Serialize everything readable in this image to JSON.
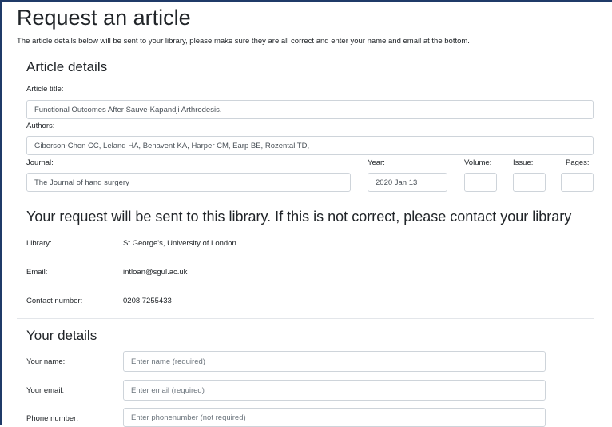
{
  "page": {
    "title": "Request an article",
    "intro": "The article details below will be sent to your library, please make sure they are all correct and enter your name and email at the bottom."
  },
  "article": {
    "heading": "Article details",
    "title_label": "Article title:",
    "title_value": "Functional Outcomes After Sauve-Kapandji Arthrodesis.",
    "authors_label": "Authors:",
    "authors_value": "Giberson-Chen CC, Leland HA, Benavent KA, Harper CM, Earp BE, Rozental TD,",
    "journal_label": "Journal:",
    "journal_value": "The Journal of hand surgery",
    "year_label": "Year:",
    "year_value": "2020 Jan 13",
    "volume_label": "Volume:",
    "volume_value": "",
    "issue_label": "Issue:",
    "issue_value": "",
    "pages_label": "Pages:",
    "pages_value": ""
  },
  "library": {
    "heading": "Your request will be sent to this library. If this is not correct, please contact your library",
    "rows": [
      {
        "label": "Library:",
        "value": "St George's, University of London"
      },
      {
        "label": "Email:",
        "value": "intloan@sgul.ac.uk"
      },
      {
        "label": "Contact number:",
        "value": "0208 7255433"
      }
    ]
  },
  "details": {
    "heading": "Your details",
    "name_label": "Your name:",
    "name_placeholder": "Enter name (required)",
    "email_label": "Your email:",
    "email_placeholder": "Enter email (required)",
    "phone_label": "Phone number:",
    "phone_placeholder": "Enter phonenumber (not required)"
  }
}
